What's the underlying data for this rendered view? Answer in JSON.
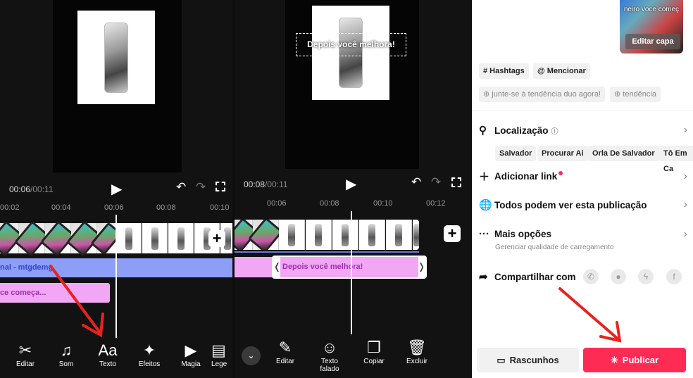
{
  "left": {
    "time_current": "00:06",
    "time_total": "/00:11",
    "ruler": [
      "00:02",
      "00:04",
      "00:06",
      "00:08",
      "00:10"
    ],
    "audio_label": "nal - mtgdemg",
    "text_clip": "ce começa...",
    "tools": [
      {
        "icon": "scissors-icon",
        "glyph": "✂",
        "label": "Editar"
      },
      {
        "icon": "music-note-icon",
        "glyph": "♫",
        "label": "Som"
      },
      {
        "icon": "text-aa-icon",
        "glyph": "Aa",
        "label": "Texto"
      },
      {
        "icon": "effects-sparkle-icon",
        "glyph": "✦",
        "label": "Efeitos"
      },
      {
        "icon": "magic-video-icon",
        "glyph": "▶",
        "label": "Magia"
      },
      {
        "icon": "captions-icon",
        "glyph": "▤",
        "label": "Lege"
      }
    ]
  },
  "middle": {
    "overlay_text": "Depois você melhora!",
    "time_current": "00:08",
    "time_total": "/00:11",
    "ruler": [
      "00:06",
      "00:08",
      "00:10",
      "00:12"
    ],
    "text_clip": "Depois você melhora!",
    "tools": [
      {
        "icon": "pencil-icon",
        "glyph": "✎",
        "label": "Editar"
      },
      {
        "icon": "speaking-head-icon",
        "glyph": "☺",
        "label": "Texto falado"
      },
      {
        "icon": "copy-icon",
        "glyph": "❐",
        "label": "Copiar"
      },
      {
        "icon": "trash-icon",
        "glyph": "🗑",
        "label": "Excluir"
      }
    ]
  },
  "right": {
    "cover_caption": "neiro voce começ",
    "edit_cover": "Editar capa",
    "hashtags": "# Hashtags",
    "mention": "@ Mencionar",
    "trend_1": "⊕ junte-se à tendência duo agora!",
    "trend_2": "⊕ tendência",
    "location": "Localização",
    "location_chips": [
      "Salvador",
      "Procurar Ai",
      "Orla De Salvador",
      "Tô Em Ca"
    ],
    "add_link": "Adicionar link",
    "visibility": "Todos podem ver esta publicação",
    "more": "Mais opções",
    "more_sub": "Gerenciar qualidade de carregamento",
    "share_with": "Compartilhar com",
    "drafts": "Rascunhos",
    "publish": "Publicar",
    "accent": "#fe2c55"
  }
}
